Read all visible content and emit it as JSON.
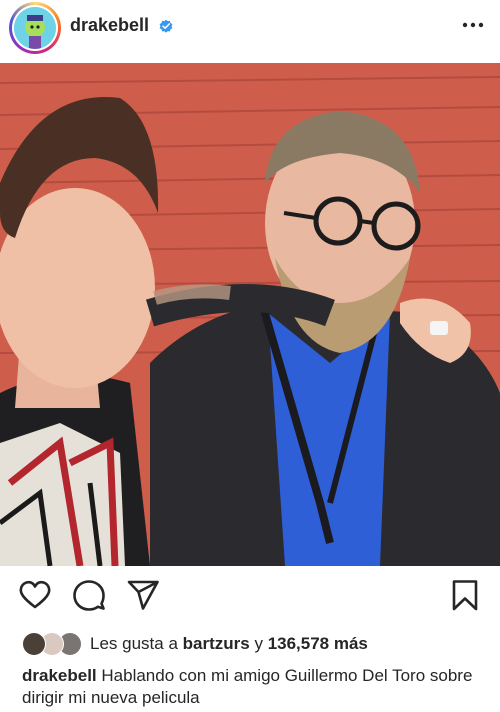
{
  "post": {
    "username": "drakebell",
    "verified": true,
    "more_icon": "more-horizontal-icon"
  },
  "actions": {
    "like_icon": "heart-icon",
    "comment_icon": "comment-icon",
    "share_icon": "send-icon",
    "save_icon": "bookmark-icon"
  },
  "likes": {
    "prefix": "Les gusta a",
    "user": "bartzurs",
    "connector": "y",
    "count": "136,578 más"
  },
  "caption": {
    "username": "drakebell",
    "text": "Hablando con mi amigo Guillermo Del Toro sobre dirigir mi nueva pelicula"
  },
  "colors": {
    "verified_blue": "#3897f0",
    "text": "#262626"
  }
}
